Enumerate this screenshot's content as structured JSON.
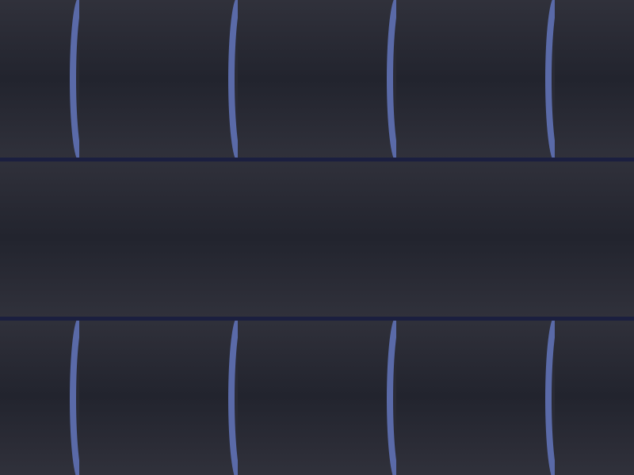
{
  "scene": {
    "colors": {
      "panel_dark": "#22242e",
      "panel_light": "#30313b",
      "divider": "#1b1f3f",
      "accent_edge": "#5a6aa8"
    },
    "bands": [
      "top",
      "middle",
      "bottom"
    ],
    "edge_columns": 4
  }
}
